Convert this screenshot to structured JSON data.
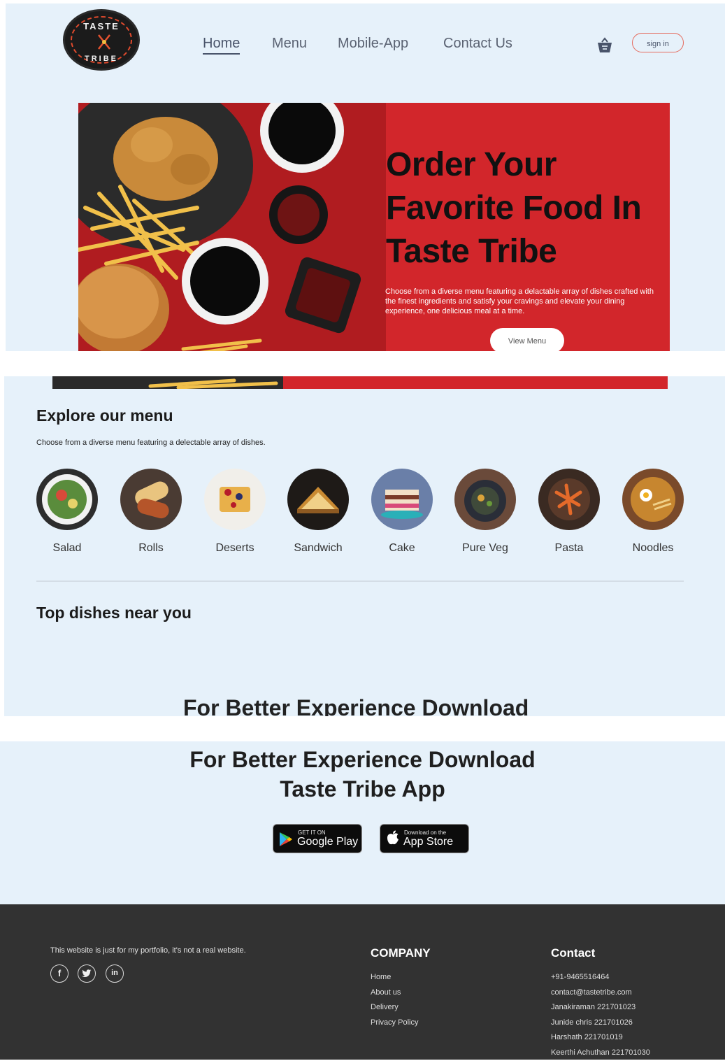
{
  "brand": {
    "logo_top": "TASTE",
    "logo_bottom": "TRIBE"
  },
  "nav": {
    "links": [
      "Home",
      "Menu",
      "Mobile-App",
      "Contact Us"
    ],
    "active": "Home",
    "signin_label": "sign in"
  },
  "hero": {
    "headline": "Order Your Favorite Food In Taste Tribe",
    "text": "Choose from a diverse menu featuring a delactable array of dishes crafted with the finest ingredients and satisfy your cravings and elevate your dining experience, one delicious meal at a time.",
    "button": "View Menu"
  },
  "menu": {
    "title": "Explore our menu",
    "subtitle": "Choose from a diverse menu featuring a delectable array of dishes.",
    "items": [
      {
        "label": "Salad",
        "color": "#5a8c3c"
      },
      {
        "label": "Rolls",
        "color": "#b5552a"
      },
      {
        "label": "Deserts",
        "color": "#e8b04a"
      },
      {
        "label": "Sandwich",
        "color": "#c98a32"
      },
      {
        "label": "Cake",
        "color": "#6a7fa8"
      },
      {
        "label": "Pure Veg",
        "color": "#3f4a3a"
      },
      {
        "label": "Pasta",
        "color": "#d9622a"
      },
      {
        "label": "Noodles",
        "color": "#c7862f"
      }
    ]
  },
  "top_dishes": {
    "title": "Top dishes near you"
  },
  "app": {
    "heading_cut": "For Better Experience Download",
    "heading_line1": "For Better Experience Download",
    "heading_line2": "Taste Tribe App",
    "google": {
      "small": "GET IT ON",
      "big": "Google Play"
    },
    "apple": {
      "small": "Download on the",
      "big": "App Store"
    }
  },
  "footer": {
    "note": "This website is just for my portfolio, it's not a real website.",
    "social": [
      "f",
      "t",
      "in"
    ],
    "company_title": "COMPANY",
    "company_links": [
      "Home",
      "About us",
      "Delivery",
      "Privacy Policy"
    ],
    "contact_title": "Contact",
    "contact_lines": [
      "+91-9465516464",
      "contact@tastetribe.com",
      "Janakiraman 221701023",
      "Junide chris 221701026",
      "Harshath 221701019",
      "Keerthi Achuthan 221701030"
    ]
  }
}
